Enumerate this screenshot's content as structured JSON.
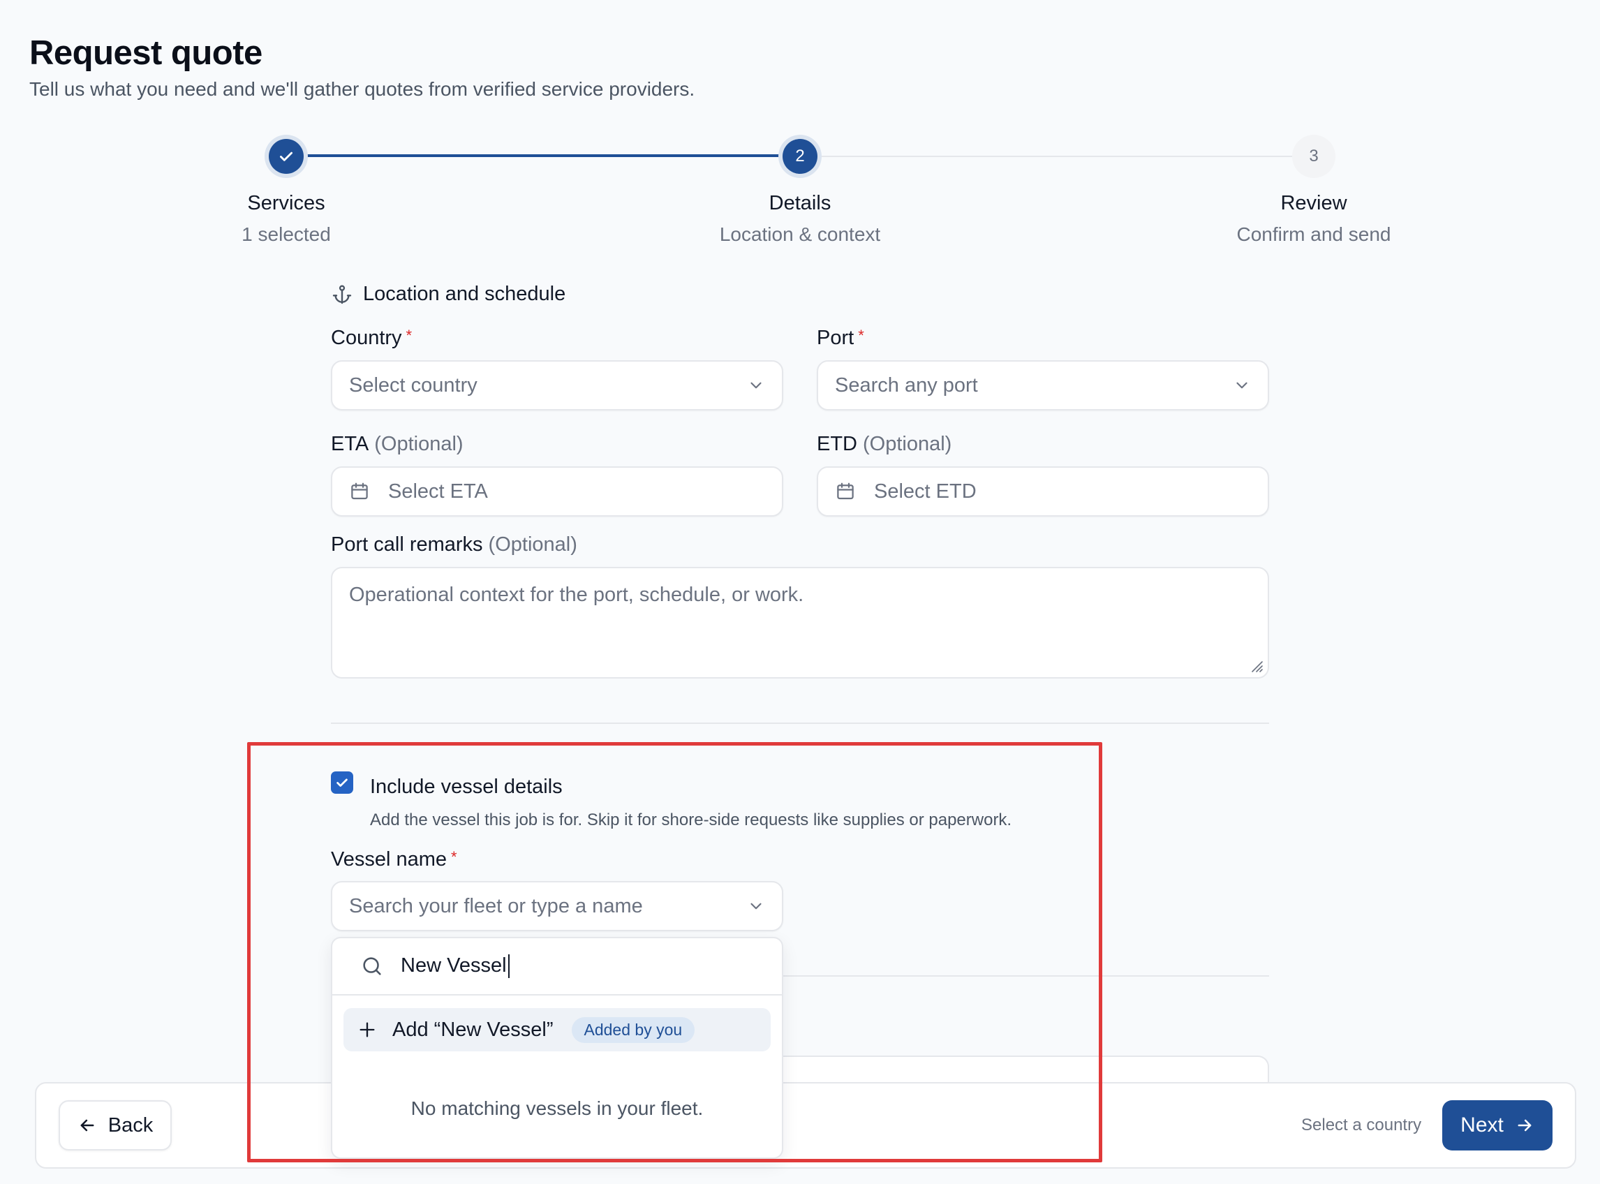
{
  "header": {
    "title": "Request quote",
    "subtitle": "Tell us what you need and we'll gather quotes from verified service providers."
  },
  "stepper": {
    "steps": [
      {
        "number": "1",
        "title": "Services",
        "subtitle": "1 selected",
        "state": "complete"
      },
      {
        "number": "2",
        "title": "Details",
        "subtitle": "Location & context",
        "state": "active"
      },
      {
        "number": "3",
        "title": "Review",
        "subtitle": "Confirm and send",
        "state": "upcoming"
      }
    ]
  },
  "location": {
    "heading": "Location and schedule",
    "country": {
      "label": "Country",
      "placeholder": "Select country",
      "required_mark": "*"
    },
    "port": {
      "label": "Port",
      "placeholder": "Search any port",
      "required_mark": "*"
    },
    "eta": {
      "label": "ETA",
      "optional": "(Optional)",
      "placeholder": "Select ETA"
    },
    "etd": {
      "label": "ETD",
      "optional": "(Optional)",
      "placeholder": "Select ETD"
    },
    "remarks": {
      "label": "Port call remarks",
      "optional": "(Optional)",
      "placeholder": "Operational context for the port, schedule, or work."
    }
  },
  "vessel": {
    "include_label": "Include vessel details",
    "include_checked": true,
    "include_help": "Add the vessel this job is for. Skip it for shore-side requests like supplies or paperwork.",
    "name_label": "Vessel name",
    "required_mark": "*",
    "name_placeholder": "Search your fleet or type a name",
    "search_value": "New Vessel",
    "add_option": "Add “New Vessel”",
    "add_badge": "Added by you",
    "empty_message": "No matching vessels in your fleet."
  },
  "footer": {
    "back_label": "Back",
    "hint": "Select a country",
    "next_label": "Next"
  },
  "colors": {
    "primary": "#1f4f96",
    "checkbox": "#2563c4",
    "required": "#dc2626",
    "highlight": "#e03a3a"
  }
}
